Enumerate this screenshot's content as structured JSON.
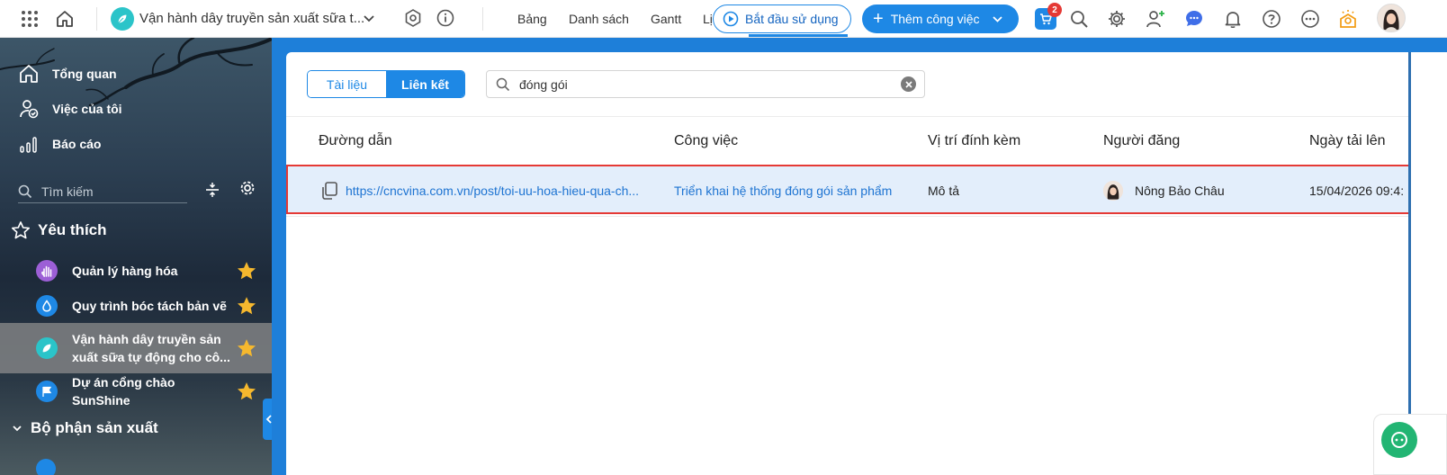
{
  "topbar": {
    "project_title": "Vận hành dây truyền sản xuất sữa t...",
    "view_tabs": [
      "Bảng",
      "Danh sách",
      "Gantt",
      "Lị"
    ],
    "start_button": "Bắt đầu sử dụng",
    "add_button": "Thêm công việc",
    "cart_badge": "2",
    "icons": [
      "app-grid-icon",
      "home-icon",
      "settings-badge-icon",
      "info-icon",
      "cart-icon",
      "search-icon",
      "gear-icon",
      "add-user-icon",
      "chat-icon",
      "bell-icon",
      "help-icon",
      "more-icon",
      "lightbulb-icon",
      "user-avatar"
    ]
  },
  "sidebar": {
    "nav": [
      {
        "label": "Tổng quan",
        "icon": "home-icon"
      },
      {
        "label": "Việc của tôi",
        "icon": "user-check-icon"
      },
      {
        "label": "Báo cáo",
        "icon": "chart-icon"
      }
    ],
    "search_placeholder": "Tìm kiếm",
    "favorites_title": "Yêu thích",
    "favorites": [
      {
        "label": "Quản lý hàng hóa",
        "color": "#9c5fd6",
        "icon": "hand-icon"
      },
      {
        "label": "Quy trình bóc tách bản vẽ",
        "color": "#1e88e5",
        "icon": "drop-icon"
      },
      {
        "label": "Vận hành dây truyền sản xuất sữa tự động cho cô...",
        "color": "#2bc4c9",
        "icon": "leaf-icon",
        "active": true
      },
      {
        "label": "Dự án cổng chào SunShine",
        "color": "#1e88e5",
        "icon": "flag-icon"
      }
    ],
    "department_title": "Bộ phận sản xuất",
    "star_color": "#f5b82e"
  },
  "main": {
    "segments": {
      "documents": "Tài liệu",
      "links": "Liên kết",
      "active": "links"
    },
    "search_value": "đóng gói",
    "columns": [
      "Đường dẫn",
      "Công việc",
      "Vị trí đính kèm",
      "Người đăng",
      "Ngày tải lên"
    ],
    "rows": [
      {
        "url": "https://cncvina.com.vn/post/toi-uu-hoa-hieu-qua-ch...",
        "task": "Triển khai hệ thống đóng gói sản phẩm",
        "location": "Mô tả",
        "poster": "Nông Bảo Châu",
        "uploaded": "15/04/2026 09:4:"
      }
    ]
  },
  "colors": {
    "accent": "#1e88e5",
    "highlight_border": "#e53935",
    "row_selected": "#e3eefb"
  }
}
